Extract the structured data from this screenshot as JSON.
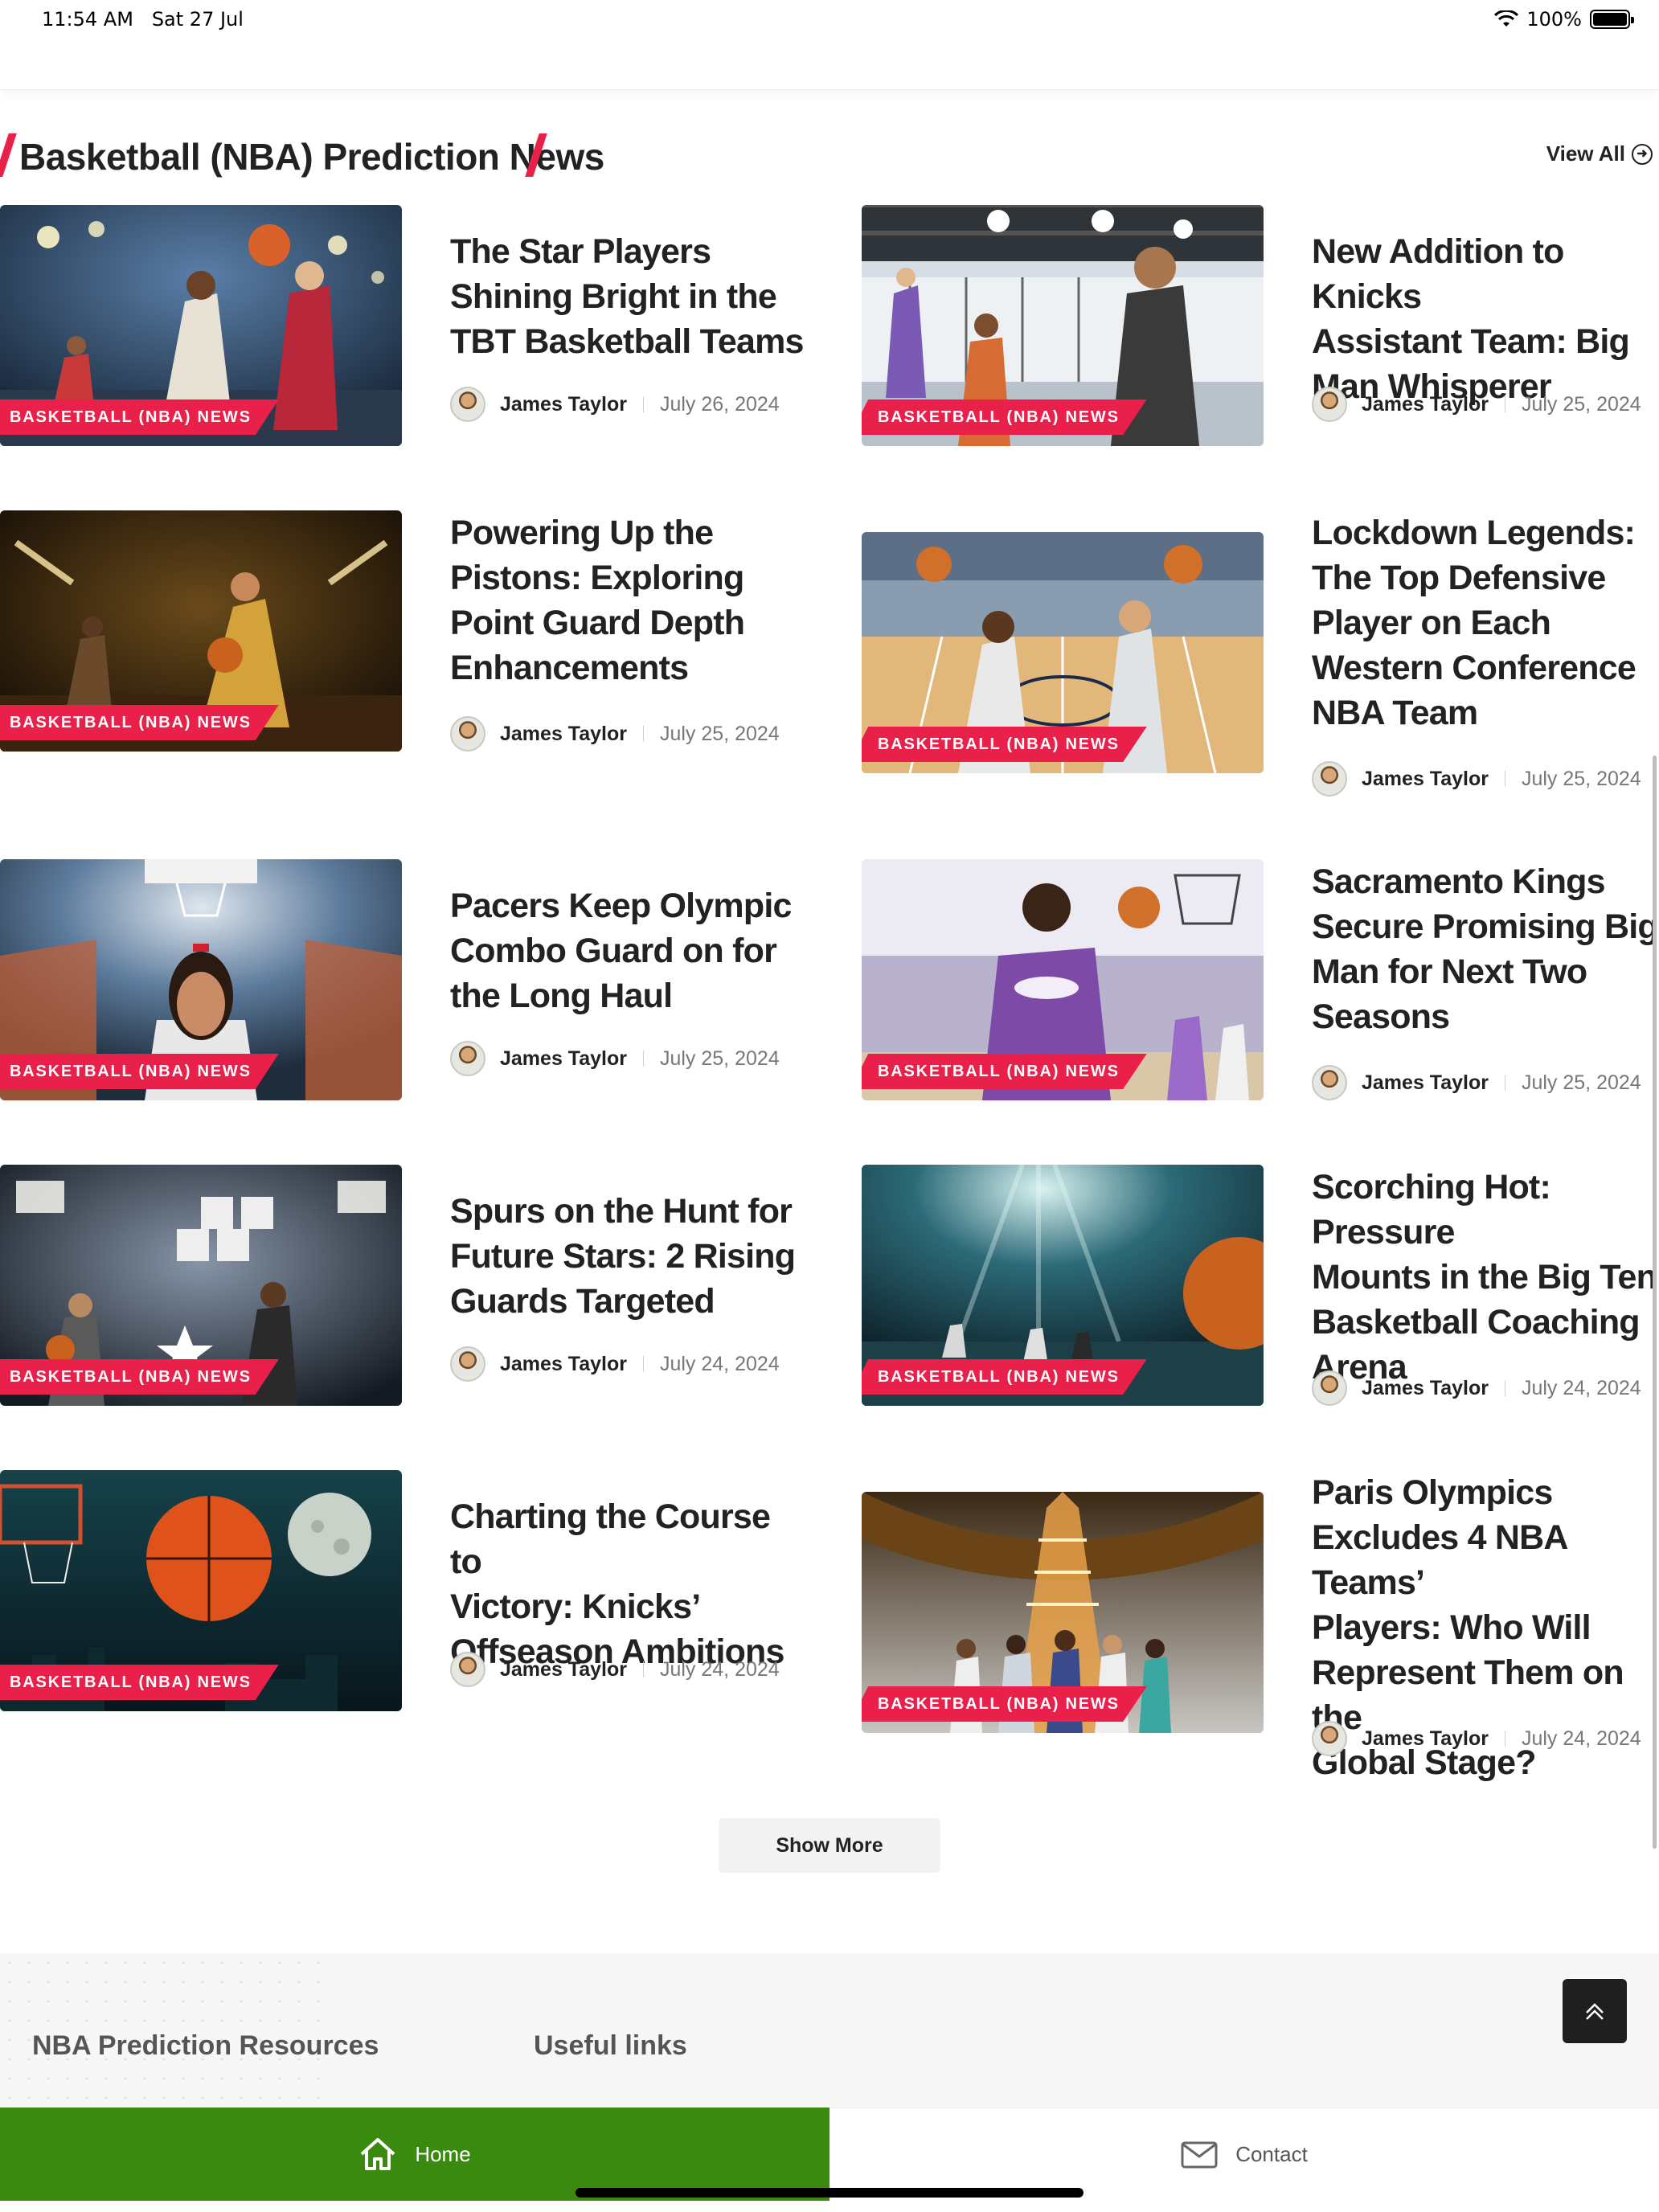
{
  "status_bar": {
    "time": "11:54 AM",
    "date": "Sat 27 Jul",
    "battery": "100%"
  },
  "section": {
    "title": "Basketball (NBA) Prediction News",
    "view_all": "View All"
  },
  "category_label": "BASKETBALL (NBA) NEWS",
  "articles": [
    {
      "title_lines": [
        "The Star Players",
        "Shining Bright in the",
        "TBT Basketball Teams"
      ],
      "author": "James Taylor",
      "date": "July 26, 2024"
    },
    {
      "title_lines": [
        "New Addition to Knicks",
        "Assistant Team: Big",
        "Man Whisperer"
      ],
      "author": "James Taylor",
      "date": "July 25, 2024"
    },
    {
      "title_lines": [
        "Powering Up the",
        "Pistons: Exploring",
        "Point Guard Depth",
        "Enhancements"
      ],
      "author": "James Taylor",
      "date": "July 25, 2024"
    },
    {
      "title_lines": [
        "Lockdown Legends:",
        "The Top Defensive",
        "Player on Each",
        "Western Conference",
        "NBA Team"
      ],
      "author": "James Taylor",
      "date": "July 25, 2024"
    },
    {
      "title_lines": [
        "Pacers Keep Olympic",
        "Combo Guard on for",
        "the Long Haul"
      ],
      "author": "James Taylor",
      "date": "July 25, 2024"
    },
    {
      "title_lines": [
        "Sacramento Kings",
        "Secure Promising Big",
        "Man for Next Two",
        "Seasons"
      ],
      "author": "James Taylor",
      "date": "July 25, 2024"
    },
    {
      "title_lines": [
        "Spurs on the Hunt for",
        "Future Stars: 2 Rising",
        "Guards Targeted"
      ],
      "author": "James Taylor",
      "date": "July 24, 2024"
    },
    {
      "title_lines": [
        "Scorching Hot: Pressure",
        "Mounts in the Big Ten",
        "Basketball Coaching",
        "Arena"
      ],
      "author": "James Taylor",
      "date": "July 24, 2024"
    },
    {
      "title_lines": [
        "Charting the Course to",
        "Victory: Knicks’",
        "Offseason Ambitions"
      ],
      "author": "James Taylor",
      "date": "July 24, 2024"
    },
    {
      "title_lines": [
        "Paris Olympics",
        "Excludes 4 NBA Teams’",
        "Players: Who Will",
        "Represent Them on the",
        "Global Stage?"
      ],
      "author": "James Taylor",
      "date": "July 24, 2024"
    }
  ],
  "show_more": "Show More",
  "footer": {
    "col1": "NBA Prediction Resources",
    "col2": "Useful links"
  },
  "tabbar": {
    "home": "Home",
    "contact": "Contact"
  },
  "colors": {
    "accent": "#e8204a",
    "home_tab": "#3a8a10"
  }
}
